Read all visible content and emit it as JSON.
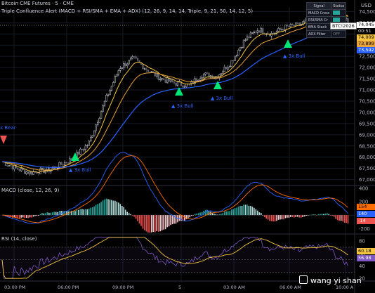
{
  "header": {
    "symbol_title": "Bitcoin CME Futures · 5 · CME",
    "indicator_title": "Triple Confluence Alert (MACD + RSI/SMA + EMA + ADX) (12, 26, 9, 14, 14, Triple, 9, 21, 50, 14, 12, 5)"
  },
  "signal_table": {
    "headers": [
      "Signal",
      "Status"
    ],
    "rows": [
      {
        "label": "MACD Cross",
        "status_color": "#26a69a"
      },
      {
        "label": "RSI/SMA Cr",
        "status_color": "#26a69a"
      },
      {
        "label": "EMA Stack",
        "status_color": "#26a69a"
      },
      {
        "label": "ADX Filter",
        "status_text": "OFF"
      }
    ]
  },
  "price_axis": {
    "currency": "USD",
    "ticks": [
      "74,500",
      "74,000",
      "73,500",
      "73,000",
      "72,500",
      "72,000",
      "71,500",
      "71,000",
      "70,500",
      "70,000",
      "69,500",
      "69,000",
      "68,500",
      "68,000",
      "67,500",
      "67,000"
    ]
  },
  "price_tags": {
    "last": "74,045",
    "countdown": "00:51",
    "ema_fast": "74,009",
    "ema_mid": "73,899",
    "ema_slow": "73,542",
    "symbol_tag": "BTC!2026"
  },
  "signals": {
    "bear_label": "x Bear",
    "bull_label": "▲ 3x Bull"
  },
  "macd_pane": {
    "title": "MACD (close, 12, 26, 9)",
    "axis_ticks": [
      "400",
      "200",
      "0",
      "-200"
    ],
    "tags": [
      "154",
      "140",
      "-14"
    ]
  },
  "rsi_pane": {
    "title": "RSI (14, close)",
    "axis_ticks": [
      "80",
      "60",
      "40",
      "20"
    ],
    "tags": [
      "60.18",
      "56.98"
    ]
  },
  "time_axis": [
    "03:00 PM",
    "06:00 PM",
    "09:00 PM",
    "5",
    "03:00 AM",
    "06:00 AM",
    "10:00 A"
  ],
  "watermark": "wang yi shan",
  "colors": {
    "up": "#26a69a",
    "down": "#ef5350",
    "ema_fast": "#f5c542",
    "ema_mid": "#e8a23a",
    "ema_slow": "#2962ff",
    "macd_line": "#2962ff",
    "signal_line": "#ff6d00",
    "rsi_line": "#7e57c2",
    "rsi_sma": "#f5c542"
  }
}
